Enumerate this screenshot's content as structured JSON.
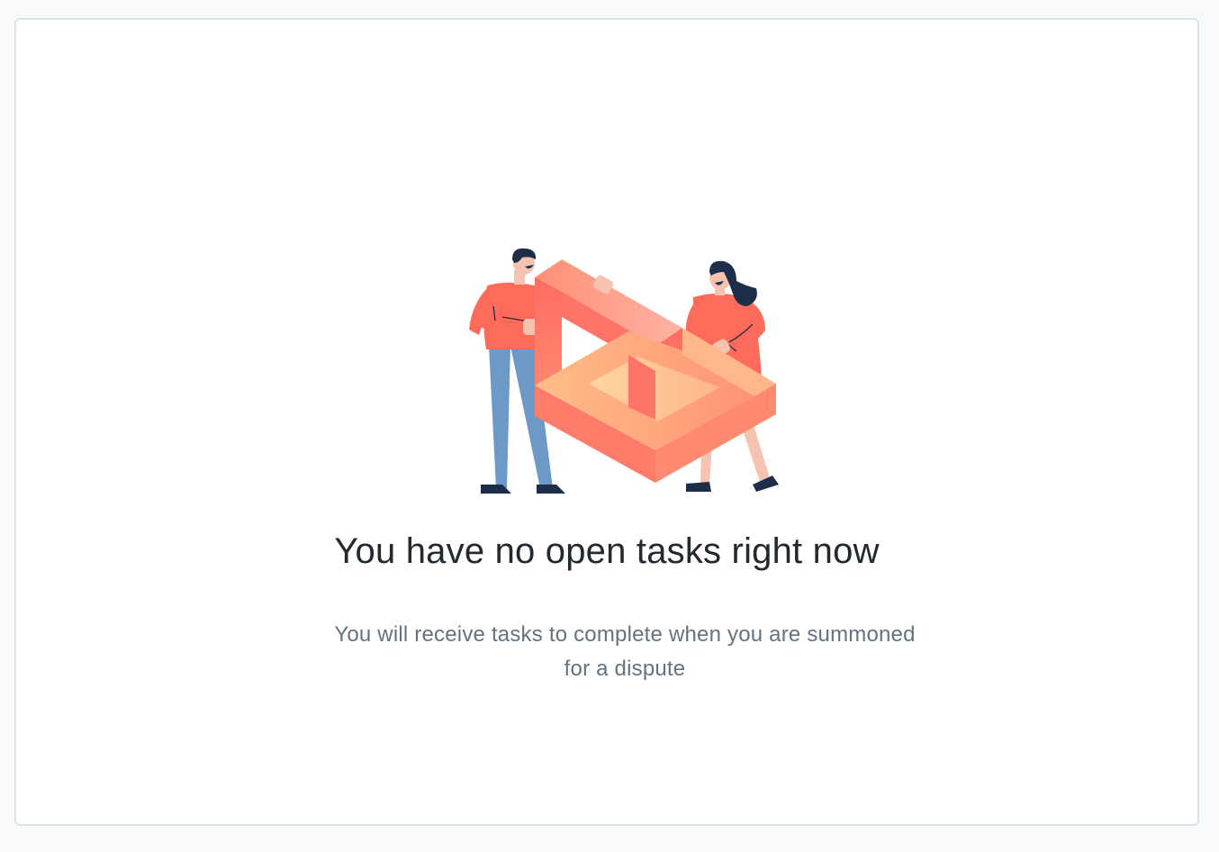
{
  "empty_state": {
    "title": "You have no open tasks right now",
    "message": "You will receive tasks to complete when you are summoned for a dispute",
    "illustration": "people-holding-impossible-shape-illustration"
  },
  "colors": {
    "background": "#f8f9fb",
    "card": "#ffffff",
    "card_border": "#dde2ea",
    "title": "#23292f",
    "message": "#637381",
    "shape_light": "#ffc58a",
    "shape_mid": "#ff8a6e",
    "shape_dark": "#ff6260",
    "shirt": "#ff6b5b",
    "pants": "#6c99c6",
    "hair": "#1c2e4a",
    "skin": "#f6c3b0"
  }
}
